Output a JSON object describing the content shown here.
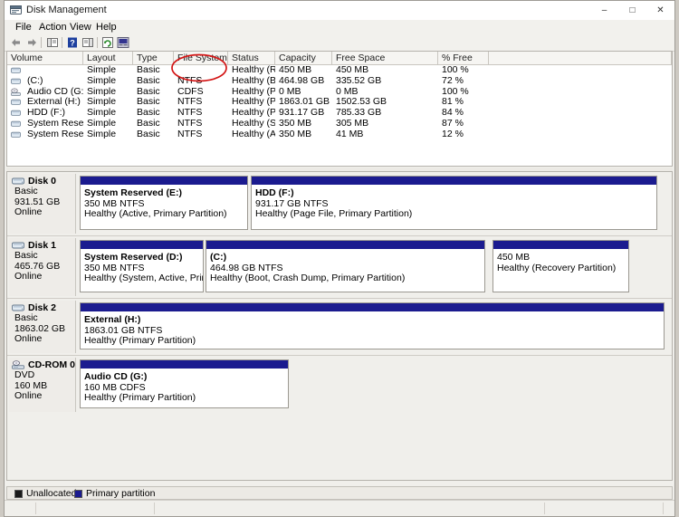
{
  "window": {
    "title": "Disk Management",
    "title_icon": "disk-management-icon",
    "minimize": "–",
    "maximize": "□",
    "close": "✕"
  },
  "menubar": {
    "items": [
      "File",
      "Action",
      "View",
      "Help"
    ]
  },
  "toolbar": {
    "items": [
      "back-arrow-icon",
      "forward-arrow-icon",
      "show-hide-console-tree-icon",
      "help-icon",
      "show-hide-action-pane-icon",
      "refresh-icon",
      "properties-icon"
    ]
  },
  "volume_list": {
    "columns": [
      "Volume",
      "Layout",
      "Type",
      "File System",
      "Status",
      "Capacity",
      "Free Space",
      "% Free",
      ""
    ],
    "rows": [
      {
        "volume": "",
        "icon": "volume-icon",
        "layout": "Simple",
        "type": "Basic",
        "fs": "",
        "status": "Healthy (R...",
        "capacity": "450 MB",
        "free": "450 MB",
        "pct": "100 %"
      },
      {
        "volume": "(C:)",
        "icon": "volume-icon",
        "layout": "Simple",
        "type": "Basic",
        "fs": "NTFS",
        "status": "Healthy (B...",
        "capacity": "464.98 GB",
        "free": "335.52 GB",
        "pct": "72 %"
      },
      {
        "volume": "Audio CD (G:)",
        "icon": "cdrom-icon",
        "layout": "Simple",
        "type": "Basic",
        "fs": "CDFS",
        "status": "Healthy (P...",
        "capacity": "0 MB",
        "free": "0 MB",
        "pct": "100 %"
      },
      {
        "volume": "External (H:)",
        "icon": "volume-icon",
        "layout": "Simple",
        "type": "Basic",
        "fs": "NTFS",
        "status": "Healthy (P...",
        "capacity": "1863.01 GB",
        "free": "1502.53 GB",
        "pct": "81 %"
      },
      {
        "volume": "HDD (F:)",
        "icon": "volume-icon",
        "layout": "Simple",
        "type": "Basic",
        "fs": "NTFS",
        "status": "Healthy (P...",
        "capacity": "931.17 GB",
        "free": "785.33 GB",
        "pct": "84 %"
      },
      {
        "volume": "System Reserved (...",
        "icon": "volume-icon",
        "layout": "Simple",
        "type": "Basic",
        "fs": "NTFS",
        "status": "Healthy (S...",
        "capacity": "350 MB",
        "free": "305 MB",
        "pct": "87 %"
      },
      {
        "volume": "System Reserved (...",
        "icon": "volume-icon",
        "layout": "Simple",
        "type": "Basic",
        "fs": "NTFS",
        "status": "Healthy (A...",
        "capacity": "350 MB",
        "free": "41 MB",
        "pct": "12 %"
      }
    ]
  },
  "disks": [
    {
      "name": "Disk 0",
      "icon": "disk-icon",
      "kind": "Basic",
      "size": "931.51 GB",
      "state": "Online",
      "partitions": [
        {
          "title": "System Reserved  (E:)",
          "line1": "350 MB NTFS",
          "line2": "Healthy (Active, Primary Partition)"
        },
        {
          "title": "HDD  (F:)",
          "line1": "931.17 GB NTFS",
          "line2": "Healthy (Page File, Primary Partition)"
        }
      ]
    },
    {
      "name": "Disk 1",
      "icon": "disk-icon",
      "kind": "Basic",
      "size": "465.76 GB",
      "state": "Online",
      "partitions": [
        {
          "title": "System Reserved  (D:)",
          "line1": "350 MB NTFS",
          "line2": "Healthy (System, Active, Primary Part"
        },
        {
          "title": "(C:)",
          "line1": "464.98 GB NTFS",
          "line2": "Healthy (Boot, Crash Dump, Primary Partition)"
        },
        {
          "title": "",
          "line1": "450 MB",
          "line2": "Healthy (Recovery Partition)"
        }
      ]
    },
    {
      "name": "Disk 2",
      "icon": "disk-icon",
      "kind": "Basic",
      "size": "1863.02 GB",
      "state": "Online",
      "partitions": [
        {
          "title": "External  (H:)",
          "line1": "1863.01 GB NTFS",
          "line2": "Healthy (Primary Partition)"
        }
      ]
    },
    {
      "name": "CD-ROM 0",
      "icon": "cdrom-drive-icon",
      "kind": "DVD",
      "size": "160 MB",
      "state": "Online",
      "partitions": [
        {
          "title": "Audio CD  (G:)",
          "line1": "160 MB CDFS",
          "line2": "Healthy (Primary Partition)"
        }
      ]
    }
  ],
  "legend": {
    "unallocated_label": "Unallocated",
    "primary_label": "Primary partition",
    "unallocated_color": "#1a1a1a",
    "primary_color": "#1b1b8f"
  },
  "annotation": {
    "shape": "red-ellipse",
    "color": "#d31414",
    "target": "File System column"
  },
  "status_bar": {
    "text": ""
  }
}
